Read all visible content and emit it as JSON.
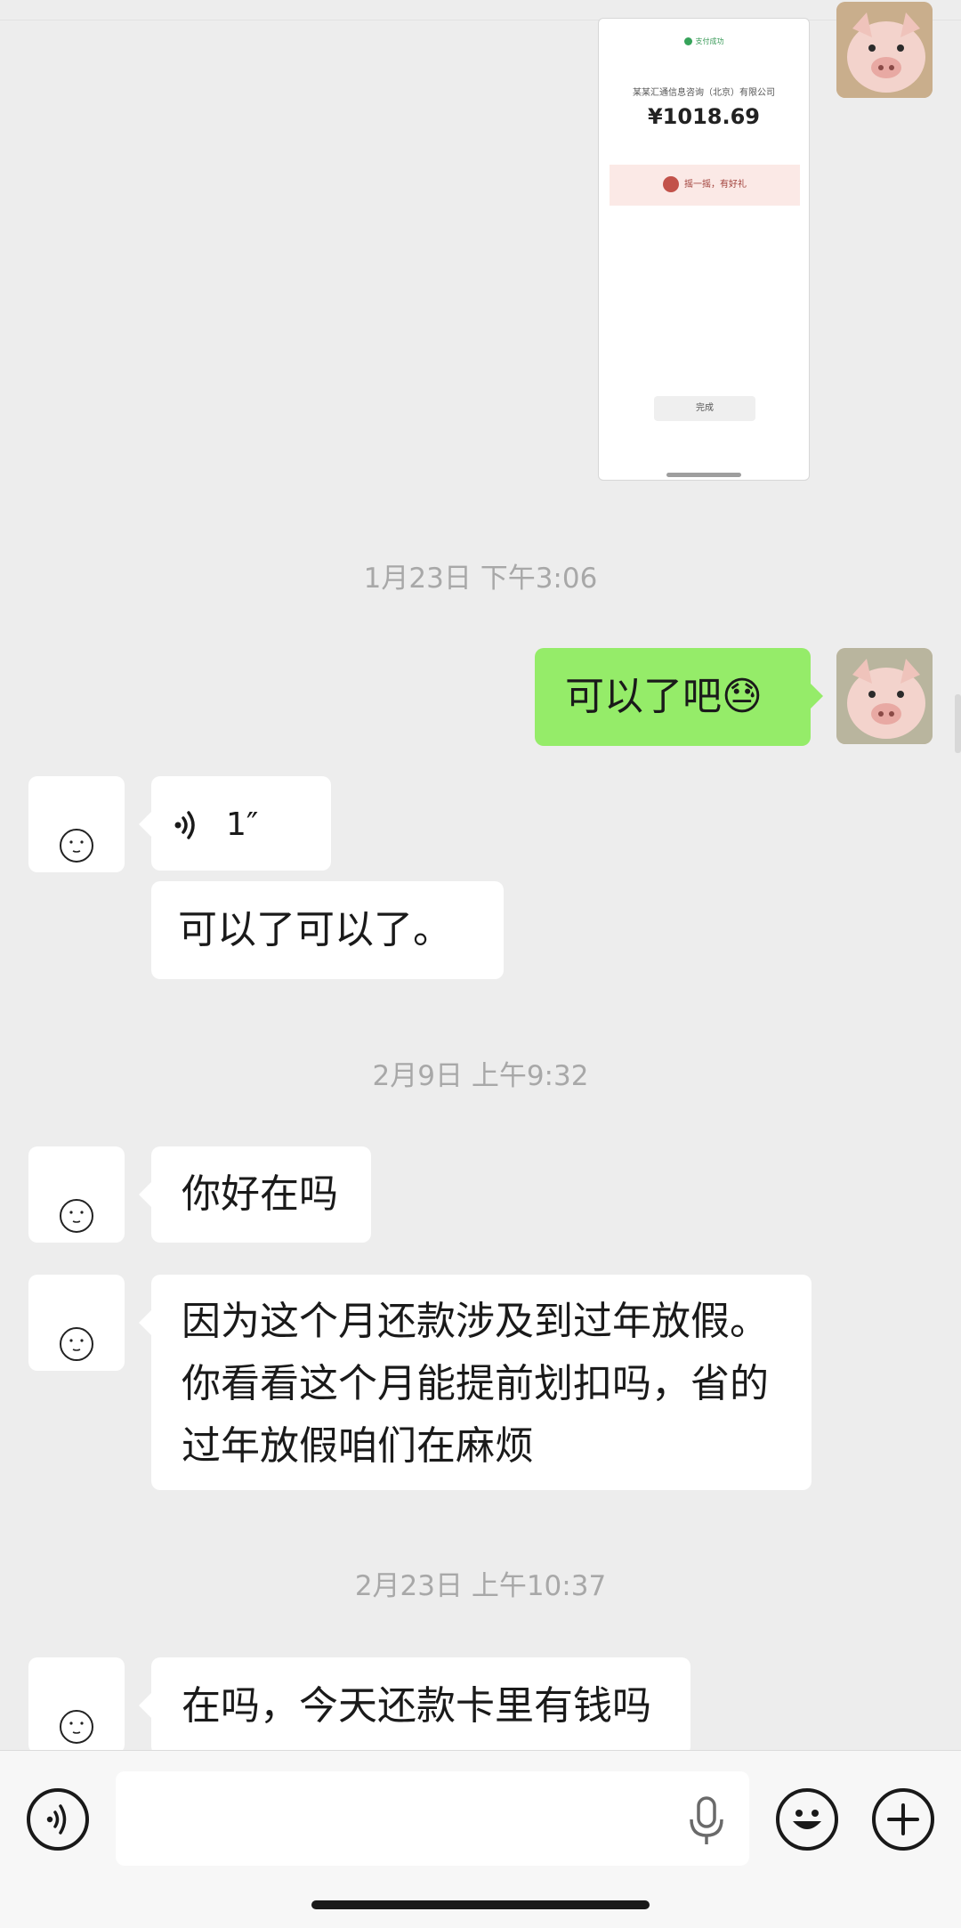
{
  "payment_screenshot": {
    "status": "支付成功",
    "payee": "某某汇通信息咨询（北京）有限公司",
    "amount": "¥1018.69",
    "promo": "摇一摇，有好礼",
    "done_button": "完成"
  },
  "messages": [
    {
      "type": "timestamp",
      "text": "1月23日 下午3:06"
    },
    {
      "type": "text",
      "side": "right",
      "text": "可以了吧😓"
    },
    {
      "type": "voice",
      "side": "left",
      "duration": "1″"
    },
    {
      "type": "text",
      "side": "left",
      "text": "可以了可以了。"
    },
    {
      "type": "timestamp",
      "text": "2月9日 上午9:32"
    },
    {
      "type": "text",
      "side": "left",
      "text": "你好在吗"
    },
    {
      "type": "text",
      "side": "left",
      "lines": [
        "因为这个月还款涉及到过年放假。",
        "你看看这个月能提前划扣吗，省的",
        "过年放假咱们在麻烦"
      ]
    },
    {
      "type": "timestamp",
      "text": "2月23日 上午10:37"
    },
    {
      "type": "text",
      "side": "left",
      "text": "在吗，今天还款卡里有钱吗"
    }
  ],
  "input_bar": {
    "voice_toggle_icon": "voice-wave-icon",
    "mic_icon": "microphone-icon",
    "emoji_icon": "smiley-icon",
    "add_icon": "plus-icon",
    "text": ""
  },
  "colors": {
    "background": "#ededed",
    "self_bubble": "#95ec69",
    "other_bubble": "#ffffff",
    "timestamp": "#a8a8a8"
  }
}
